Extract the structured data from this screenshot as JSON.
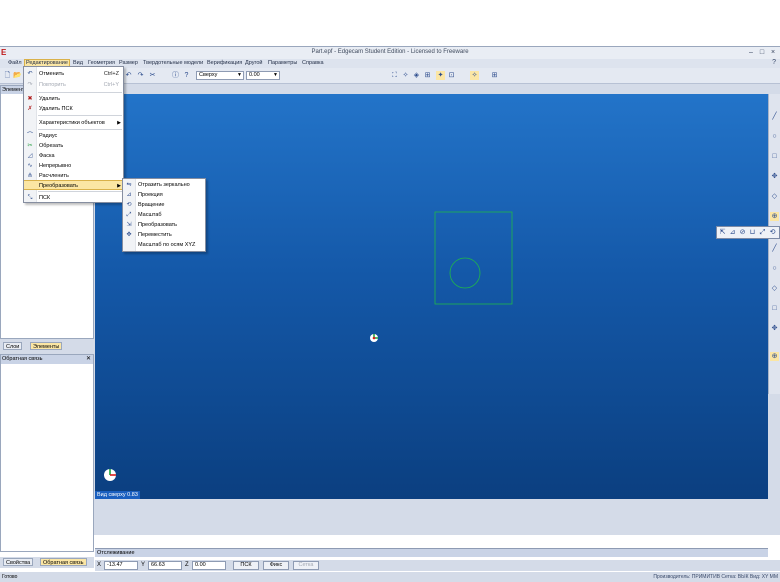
{
  "window": {
    "title": "Part.epf - Edgecam Student Edition - Licensed to Freeware",
    "logo": "Е",
    "min": "–",
    "max": "□",
    "close": "×"
  },
  "menubar": {
    "items": [
      "Файл",
      "Редактирование",
      "Вид",
      "Геометрия",
      "Размер",
      "Твердотельные модели",
      "Верификация",
      "Другой",
      "Параметры",
      "Справка"
    ],
    "active_index": 1
  },
  "toolbar": {
    "view_select": "Сверху",
    "z_select": "0.00"
  },
  "panels": {
    "elements_header": "Элементы",
    "tab_layers": "Слои",
    "tab_elements": "Элементы",
    "feedback_header": "Обратная связь",
    "bottom_tab_props": "Свойства",
    "bottom_tab_feedback": "Обратная связь"
  },
  "viewport": {
    "view_label": "Вид сверху 0.83",
    "background_top": "#2374c9",
    "background_bottom": "#0b3f80",
    "geometry_color": "#1fb84a"
  },
  "tracking": {
    "label": "Отслеживание"
  },
  "coords": {
    "x_label": "X",
    "x_value": "-13.47",
    "y_label": "Y",
    "y_value": "66.63",
    "z_label": "Z",
    "z_value": "0.00",
    "btn_ucs": "ПСК",
    "btn_fix": "Фикс",
    "btn_snap": "Сетка"
  },
  "statusbar": {
    "left": "Готово",
    "right": "Производитель: ПРИМИТИВ  Сетка: ВЫК  Вид: XY  ММ"
  },
  "edit_menu": {
    "items": [
      {
        "label": "Отменить",
        "shortcut": "Ctrl+Z",
        "icon": "undo-icon",
        "glyph": "↶",
        "disabled": false
      },
      {
        "label": "Повторить",
        "shortcut": "Ctrl+Y",
        "icon": "redo-icon",
        "glyph": "↷",
        "disabled": true
      },
      {
        "label": "Удалить",
        "shortcut": "",
        "icon": "delete-icon",
        "glyph": "✖",
        "disabled": false
      },
      {
        "label": "Удалить ПСК",
        "shortcut": "",
        "icon": "delete-ucs-icon",
        "glyph": "✗",
        "disabled": false
      },
      {
        "label": "Характеристики объектов",
        "shortcut": "",
        "icon": "",
        "glyph": "",
        "disabled": false,
        "submenu": true
      },
      {
        "label": "Радиус",
        "shortcut": "",
        "icon": "radius-icon",
        "glyph": "⌒",
        "disabled": false
      },
      {
        "label": "Обрезать",
        "shortcut": "",
        "icon": "trim-icon",
        "glyph": "✂",
        "disabled": false
      },
      {
        "label": "Фаска",
        "shortcut": "",
        "icon": "chamfer-icon",
        "glyph": "◿",
        "disabled": false
      },
      {
        "label": "Непрерывно",
        "shortcut": "",
        "icon": "continuous-icon",
        "glyph": "∿",
        "disabled": false
      },
      {
        "label": "Расчленить",
        "shortcut": "",
        "icon": "explode-icon",
        "glyph": "⋔",
        "disabled": false
      },
      {
        "label": "Преобразовать",
        "shortcut": "",
        "icon": "",
        "glyph": "",
        "disabled": false,
        "submenu": true,
        "highlighted": true
      },
      {
        "label": "ПСК",
        "shortcut": "",
        "icon": "ucs-icon",
        "glyph": "⤡",
        "disabled": false
      }
    ]
  },
  "transform_menu": {
    "items": [
      {
        "label": "Отразить зеркально",
        "icon": "mirror-icon",
        "glyph": "⇋"
      },
      {
        "label": "Проекция",
        "icon": "projection-icon",
        "glyph": "⊿"
      },
      {
        "label": "Вращение",
        "icon": "rotate-icon",
        "glyph": "⟲"
      },
      {
        "label": "Масштаб",
        "icon": "scale-icon",
        "glyph": "⤢"
      },
      {
        "label": "Преобразовать",
        "icon": "transform-icon",
        "glyph": "⇲"
      },
      {
        "label": "Переместить",
        "icon": "move-icon",
        "glyph": "✥"
      },
      {
        "label": "Масштаб по осям XYZ",
        "icon": "",
        "glyph": ""
      }
    ]
  },
  "icons": {
    "new": "🗋",
    "open": "📂",
    "save": "💾",
    "undo": "↶",
    "redo": "↷",
    "cut": "✂",
    "info": "ⓘ",
    "help": "?",
    "pin": "⊣",
    "close_x": "✕",
    "right1": "╱",
    "right2": "○",
    "right3": "□",
    "right4": "✥",
    "right5": "◇",
    "right6": "⊕",
    "float1": "⇱",
    "float2": "⊿",
    "float3": "⊘",
    "float4": "⊔",
    "float5": "⤢",
    "float6": "⟲",
    "snap1": "⛶",
    "snap2": "✧",
    "snap3": "◈",
    "snap4": "⊞",
    "snap5": "✦",
    "snap6": "⊡"
  }
}
